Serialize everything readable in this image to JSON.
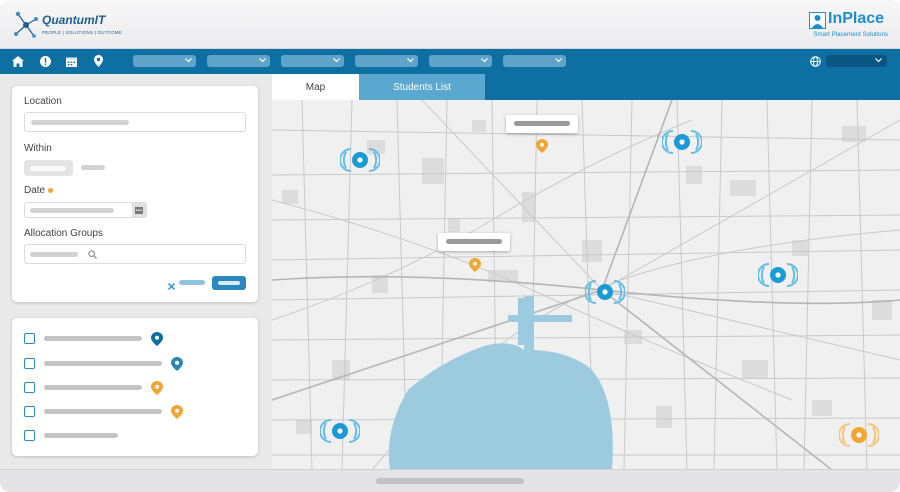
{
  "header": {
    "left_brand": "QuantumIT",
    "left_tagline": "PEOPLE | SOLUTIONS | OUTCOME",
    "right_brand": "InPlace",
    "right_tagline": "Smart Placement Solutions"
  },
  "nav": {
    "icons": [
      "home-icon",
      "info-icon",
      "calendar-icon",
      "location-pin-icon"
    ],
    "language_icon": "globe-icon"
  },
  "filters": {
    "location_label": "Location",
    "within_label": "Within",
    "date_label": "Date",
    "allocation_label": "Allocation Groups",
    "clear_icon": "close-icon",
    "calendar_icon": "calendar-icon",
    "search_icon": "search-icon"
  },
  "tabs": {
    "map_label": "Map",
    "students_label": "Students List"
  },
  "colors": {
    "brand_blue": "#0e6fa3",
    "marker_blue": "#1a9ad6",
    "marker_orange": "#f2a531",
    "water": "#9ccbe0"
  },
  "list_items": [
    {
      "pin_color": "#0e6fa3"
    },
    {
      "pin_color": "#2b87b0"
    },
    {
      "pin_color": "#f2a531"
    },
    {
      "pin_color": "#f2a531"
    },
    {
      "pin_color": ""
    }
  ]
}
